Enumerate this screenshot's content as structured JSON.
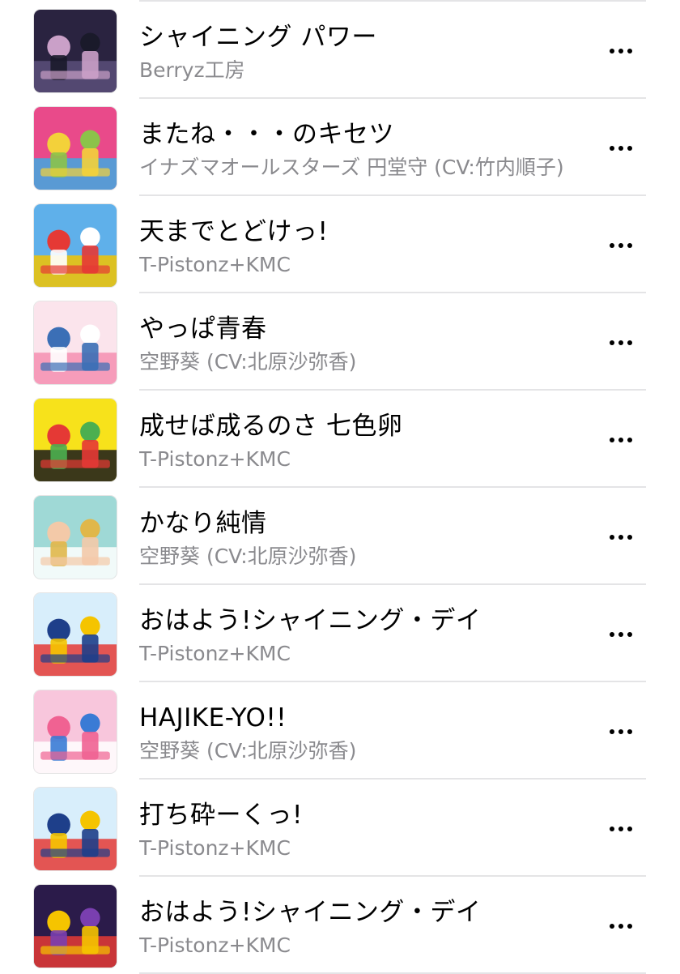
{
  "track_list": {
    "tracks": [
      {
        "title": "シャイニング パワー",
        "artist": "Berryz工房",
        "artwork": {
          "colors": [
            "#2a2340",
            "#5a4f7a",
            "#caa0c8",
            "#1a1a2a"
          ]
        }
      },
      {
        "title": "またね・・・のキセツ",
        "artist": "イナズマオールスターズ 円堂守 (CV:竹内順子)",
        "artwork": {
          "colors": [
            "#e94a8a",
            "#3fa8e0",
            "#f3d13a",
            "#8bc34a"
          ]
        }
      },
      {
        "title": "天までとどけっ!",
        "artist": "T-Pistonz+KMC",
        "artwork": {
          "colors": [
            "#5fb0ea",
            "#f2c400",
            "#e53935",
            "#ffffff"
          ]
        }
      },
      {
        "title": "やっぱ青春",
        "artist": "空野葵 (CV:北原沙弥香)",
        "artwork": {
          "colors": [
            "#fbe4ec",
            "#f48fb1",
            "#3b6fb6",
            "#ffffff"
          ]
        }
      },
      {
        "title": "成せば成るのさ 七色卵",
        "artist": "T-Pistonz+KMC",
        "artwork": {
          "colors": [
            "#f7e21b",
            "#1a1a1a",
            "#e53935",
            "#4caf50"
          ]
        }
      },
      {
        "title": "かなり純情",
        "artist": "空野葵 (CV:北原沙弥香)",
        "artwork": {
          "colors": [
            "#9fd9d6",
            "#ffffff",
            "#f3c9a8",
            "#e0b74a"
          ]
        }
      },
      {
        "title": "おはよう!シャイニング・デイ",
        "artist": "T-Pistonz+KMC",
        "artwork": {
          "colors": [
            "#d8eefb",
            "#e53935",
            "#1e3f8a",
            "#f5c400"
          ]
        }
      },
      {
        "title": "HAJIKE-YO!!",
        "artist": "空野葵 (CV:北原沙弥香)",
        "artwork": {
          "colors": [
            "#f8c6dc",
            "#ffffff",
            "#f06292",
            "#3a7bd5"
          ]
        }
      },
      {
        "title": "打ち砕ーくっ!",
        "artist": "T-Pistonz+KMC",
        "artwork": {
          "colors": [
            "#d8eefb",
            "#e53935",
            "#1e3f8a",
            "#f5c400"
          ]
        }
      },
      {
        "title": "おはよう!シャイニング・デイ",
        "artist": "T-Pistonz+KMC",
        "artwork": {
          "colors": [
            "#2b1b4a",
            "#e53935",
            "#f5c400",
            "#7a3fb0"
          ]
        }
      }
    ]
  },
  "icons": {
    "more": "more-horizontal-icon"
  },
  "colors": {
    "title_text": "#000000",
    "subtitle_text": "#8a8a8e",
    "divider": "#e4e4e6",
    "background": "#ffffff"
  }
}
